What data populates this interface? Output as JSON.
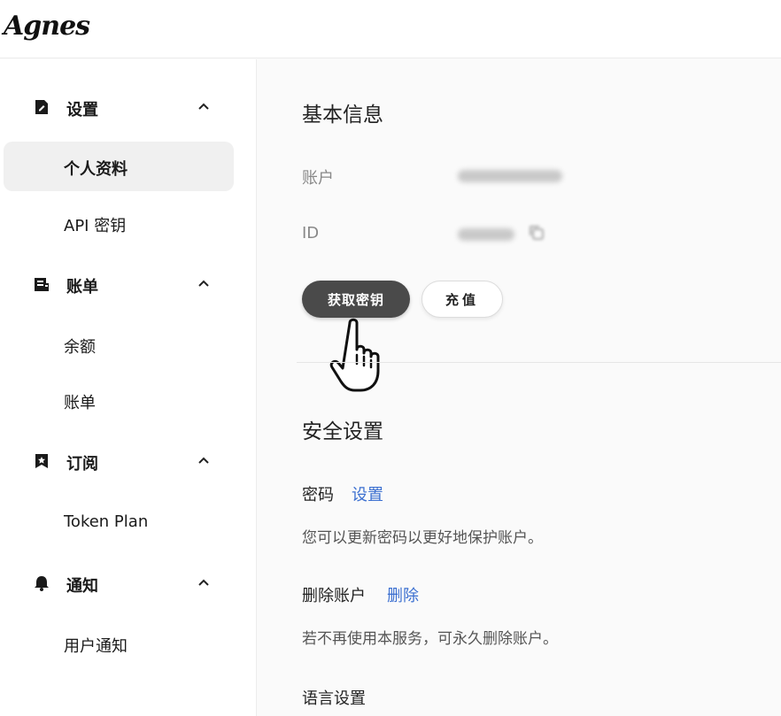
{
  "header": {
    "logo_text": "Agnes"
  },
  "sidebar": {
    "groups": [
      {
        "label": "设置",
        "icon": "document-icon",
        "items": [
          "个人资料",
          "API 密钥"
        ]
      },
      {
        "label": "账单",
        "icon": "bill-icon",
        "items": [
          "余额",
          "账单"
        ]
      },
      {
        "label": "订阅",
        "icon": "bookmark-star-icon",
        "items": [
          "Token Plan"
        ]
      },
      {
        "label": "通知",
        "icon": "bell-icon",
        "items": [
          "用户通知"
        ]
      }
    ],
    "active_item": "个人资料"
  },
  "main": {
    "basic_info": {
      "title": "基本信息",
      "account_label": "账户",
      "id_label": "ID",
      "get_key_button": "获取密钥",
      "recharge_button": "充值"
    },
    "security": {
      "title": "安全设置",
      "password_label": "密码",
      "password_link": "设置",
      "password_desc": "您可以更新密码以更好地保护账户。",
      "delete_label": "删除账户",
      "delete_link": "删除",
      "delete_desc": "若不再使用本服务，可永久删除账户。"
    },
    "language": {
      "title": "语言设置"
    }
  },
  "colors": {
    "primary_button": "#4a4a4a",
    "link": "#3b6fd0",
    "active_item_bg": "#f0f0f0"
  }
}
